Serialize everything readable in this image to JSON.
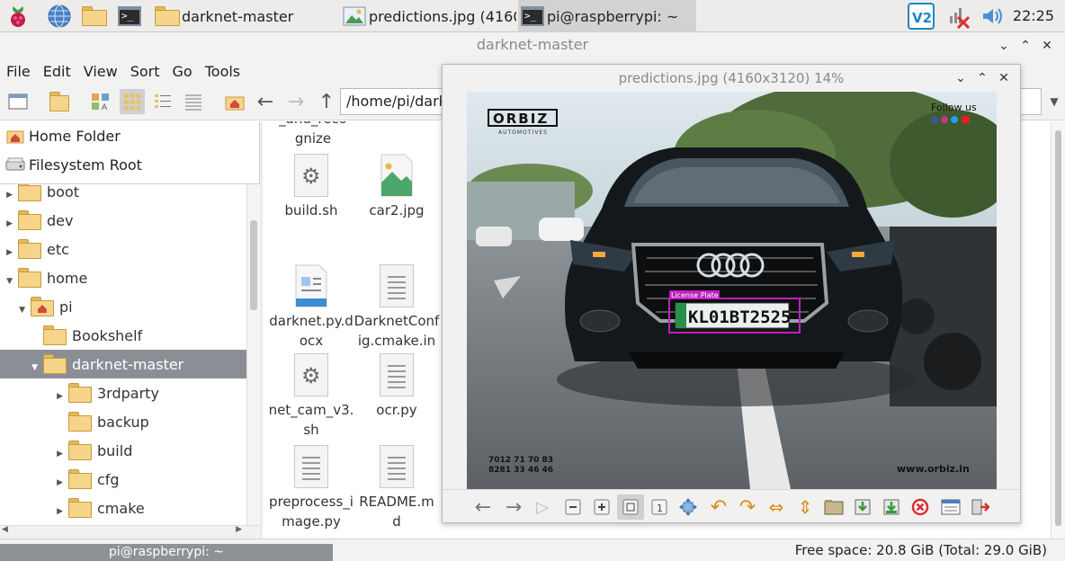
{
  "taskbar": {
    "tasks": [
      {
        "label": "darknet-master"
      },
      {
        "label": "predictions.jpg (4160..."
      },
      {
        "label": "pi@raspberrypi: ~"
      }
    ],
    "clock": "22:25"
  },
  "file_manager": {
    "title": "darknet-master",
    "menu": [
      "File",
      "Edit",
      "View",
      "Sort",
      "Go",
      "Tools"
    ],
    "path": "/home/pi/darknet-master",
    "places": [
      "Home Folder",
      "Filesystem Root"
    ],
    "tree": [
      {
        "label": "boot",
        "expander": "right"
      },
      {
        "label": "dev",
        "expander": "right"
      },
      {
        "label": "etc",
        "expander": "right"
      },
      {
        "label": "home",
        "expander": "down"
      },
      {
        "label": "pi",
        "expander": "down"
      },
      {
        "label": "Bookshelf",
        "expander": "none"
      },
      {
        "label": "darknet-master",
        "expander": "down"
      },
      {
        "label": "3rdparty",
        "expander": "right"
      },
      {
        "label": "backup",
        "expander": "none"
      },
      {
        "label": "build",
        "expander": "right"
      },
      {
        "label": "cfg",
        "expander": "right"
      },
      {
        "label": "cmake",
        "expander": "right"
      }
    ],
    "files": [
      {
        "label": "_and_reco\ngnize",
        "kind": "partial"
      },
      {
        "label": "build.sh",
        "kind": "script"
      },
      {
        "label": "car2.jpg",
        "kind": "image"
      },
      {
        "label": "darknet.py.d\nocx",
        "kind": "docx"
      },
      {
        "label": "DarknetConf\nig.cmake.in",
        "kind": "text"
      },
      {
        "label": "net_cam_v3.\nsh",
        "kind": "script"
      },
      {
        "label": "ocr.py",
        "kind": "text"
      },
      {
        "label": "preprocess_i\nmage.py",
        "kind": "text"
      },
      {
        "label": "README.m\nd",
        "kind": "text"
      }
    ],
    "status": "Free space: 20.8 GiB (Total: 29.0 GiB)",
    "terminal_tab": "pi@raspberrypi: ~"
  },
  "viewer": {
    "title": "predictions.jpg (4160x3120) 14%",
    "photo": {
      "brand": "ORBIZ",
      "brand_sub": "AUTOMOTIVES",
      "follow": "Follow us",
      "plate": "KL01BT2525",
      "detection_label": "License Plate",
      "phones": [
        "7012 71 70 83",
        "8281 33 46 46"
      ],
      "website": "www.orbiz.in"
    }
  },
  "colors": {
    "selection": "#8b8f95",
    "folder": "#f6d48a",
    "detection_box": "#c020c0",
    "close_red": "#d83030"
  }
}
